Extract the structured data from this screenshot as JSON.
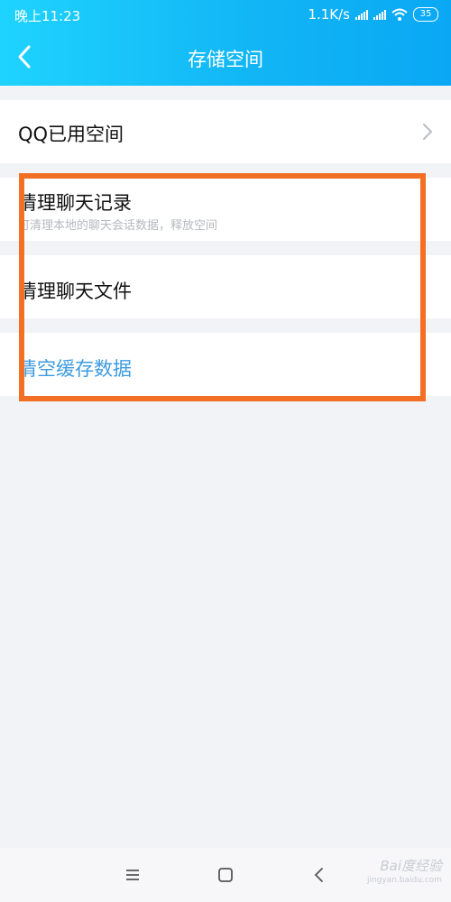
{
  "status_bar": {
    "time": "晚上11:23",
    "network_speed": "1.1K/s",
    "battery": "35"
  },
  "header": {
    "title": "存储空间",
    "back_icon": "chevron-left-icon"
  },
  "items": [
    {
      "label": "QQ已用空间",
      "has_chevron": true
    },
    {
      "label": "清理聊天记录",
      "sub": "可清理本地的聊天会话数据，释放空间"
    },
    {
      "label": "清理聊天文件"
    },
    {
      "label": "清空缓存数据",
      "color": "#3d9be0"
    }
  ],
  "highlight_color": "#f26f24",
  "bottom_nav": {
    "icons": [
      "menu-icon",
      "home-square-icon",
      "back-triangle-icon"
    ]
  },
  "watermark": {
    "text": "Bai度经验",
    "url": "jingyan.baidu.com"
  }
}
